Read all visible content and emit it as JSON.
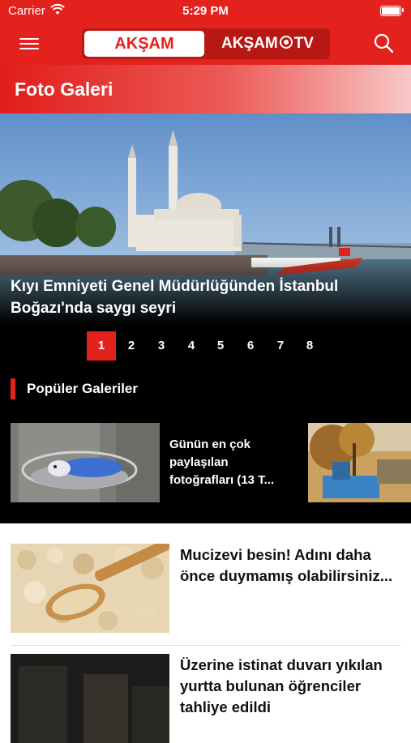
{
  "status_bar": {
    "carrier": "Carrier",
    "time": "5:29 PM"
  },
  "navbar": {
    "tab_left": "AKŞAM",
    "tab_right_a": "AKŞAM",
    "tab_right_b": "TV"
  },
  "section": {
    "title": "Foto Galeri"
  },
  "hero": {
    "caption": "Kıyı Emniyeti Genel Müdürlüğünden İstanbul Boğazı'nda saygı seyri"
  },
  "pager": {
    "pages": [
      "1",
      "2",
      "3",
      "4",
      "5",
      "6",
      "7",
      "8"
    ],
    "active": "1"
  },
  "popular": {
    "heading": "Popüler Galeriler",
    "cards": [
      {
        "title": "Günün en çok paylaşılan fotoğrafları (13 T..."
      }
    ]
  },
  "news": [
    {
      "title": "Mucizevi besin! Adını daha önce duymamış olabilirsiniz..."
    },
    {
      "title": "Üzerine istinat duvarı yıkılan yurtta bulunan öğrenciler tahliye edildi"
    }
  ],
  "colors": {
    "brand": "#e3211d",
    "dark": "#000000"
  }
}
